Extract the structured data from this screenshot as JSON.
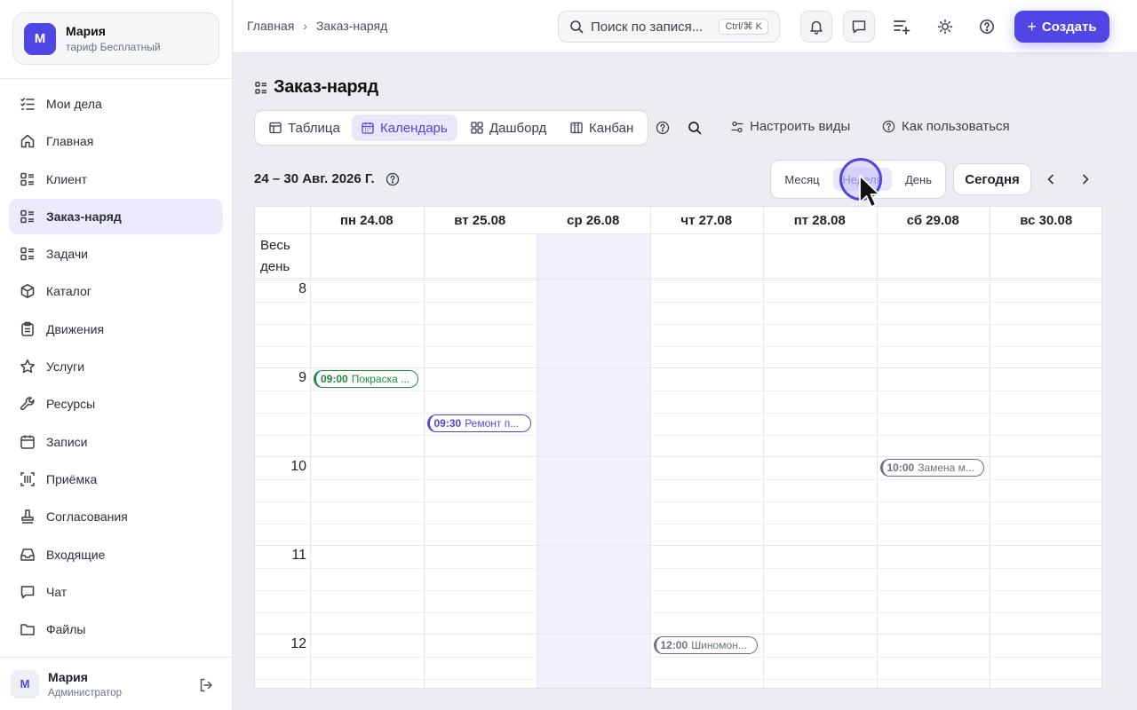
{
  "workspace": {
    "avatar": "М",
    "name": "Мария",
    "plan": "тариф Бесплатный"
  },
  "sidebar": {
    "items": [
      {
        "label": "Мои дела",
        "icon": "checklist-icon"
      },
      {
        "label": "Главная",
        "icon": "home-icon"
      },
      {
        "label": "Клиент",
        "icon": "list-icon"
      },
      {
        "label": "Заказ-наряд",
        "icon": "list-icon",
        "active": true
      },
      {
        "label": "Задачи",
        "icon": "list-icon"
      },
      {
        "label": "Каталог",
        "icon": "box-icon"
      },
      {
        "label": "Движения",
        "icon": "clipboard-icon"
      },
      {
        "label": "Услуги",
        "icon": "star-icon"
      },
      {
        "label": "Ресурсы",
        "icon": "wrench-icon"
      },
      {
        "label": "Записи",
        "icon": "calendar-icon"
      },
      {
        "label": "Приёмка",
        "icon": "scan-icon"
      },
      {
        "label": "Согласования",
        "icon": "stamp-icon"
      },
      {
        "label": "Входящие",
        "icon": "inbox-icon"
      },
      {
        "label": "Чат",
        "icon": "chat-icon"
      },
      {
        "label": "Файлы",
        "icon": "folder-icon"
      }
    ]
  },
  "user": {
    "avatar": "М",
    "name": "Мария",
    "role": "Администратор"
  },
  "topbar": {
    "breadcrumb": [
      "Главная",
      "Заказ-наряд"
    ],
    "search_placeholder": "Поиск по записям",
    "search_display": "Поиск по запися...",
    "shortcut": "Ctrl/⌘ K",
    "create_label": "Создать"
  },
  "page": {
    "title": "Заказ-наряд"
  },
  "views": {
    "tabs": [
      {
        "label": "Таблица",
        "icon": "table-icon"
      },
      {
        "label": "Календарь",
        "icon": "calendar-icon",
        "active": true
      },
      {
        "label": "Дашборд",
        "icon": "dashboard-icon"
      },
      {
        "label": "Канбан",
        "icon": "kanban-icon"
      }
    ],
    "configure_label": "Настроить виды",
    "howto_label": "Как пользоваться"
  },
  "calendar": {
    "range": "24 – 30 Авг. 2026 Г.",
    "modes": [
      "Месяц",
      "Неделя",
      "День"
    ],
    "active_mode": "Неделя",
    "today_label": "Сегодня",
    "allday_label": "Весь день",
    "days": [
      "пн 24.08",
      "вт 25.08",
      "ср 26.08",
      "чт 27.08",
      "пт 28.08",
      "сб 29.08",
      "вс 30.08"
    ],
    "today_index": 2,
    "hours": [
      "8",
      "9",
      "10",
      "11",
      "12"
    ],
    "events": [
      {
        "day": 0,
        "time": "09:00",
        "title": "Покраска ...",
        "color": "#1e8a3c",
        "start_hour": 9.0
      },
      {
        "day": 1,
        "time": "09:30",
        "title": "Ремонт п...",
        "color": "#4f46e5",
        "start_hour": 9.5
      },
      {
        "day": 5,
        "time": "10:00",
        "title": "Замена м...",
        "color": "#6b7280",
        "start_hour": 10.0
      },
      {
        "day": 3,
        "time": "12:00",
        "title": "Шиномон...",
        "color": "#6b7280",
        "start_hour": 12.0
      }
    ]
  },
  "colors": {
    "accent": "#4f46e5",
    "today_bg": "#f1f0fd",
    "event_green": "#1e8a3c"
  }
}
